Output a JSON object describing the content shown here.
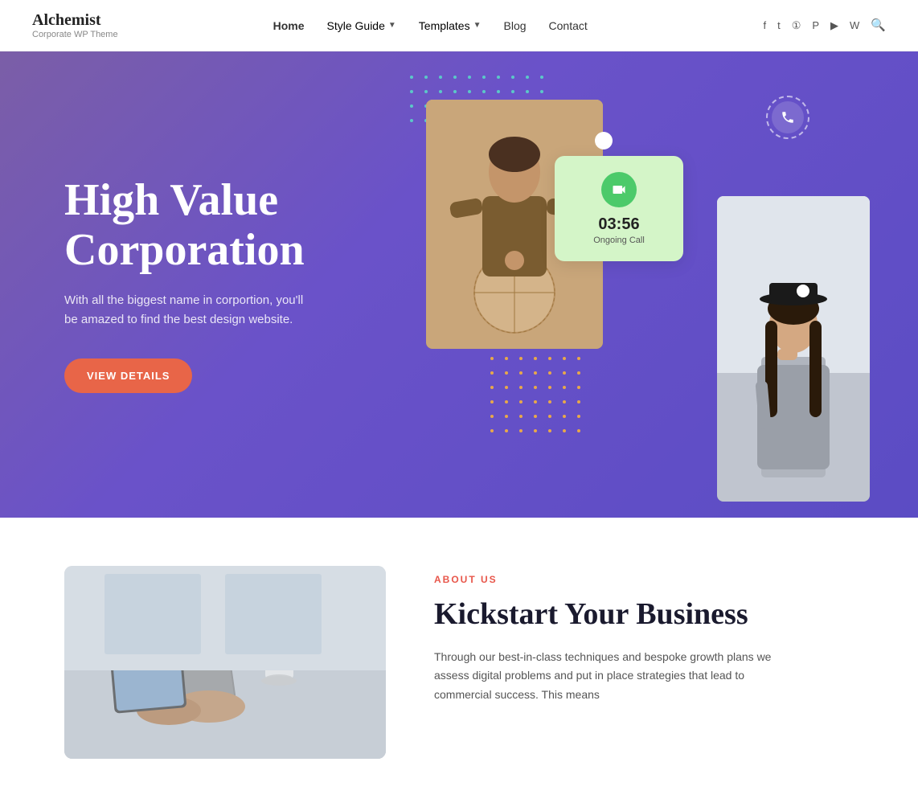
{
  "logo": {
    "name": "Alchemist",
    "tagline": "Corporate WP Theme"
  },
  "nav": {
    "links": [
      {
        "label": "Home",
        "active": true,
        "has_arrow": false
      },
      {
        "label": "Style Guide",
        "active": false,
        "has_arrow": true
      },
      {
        "label": "Templates",
        "active": false,
        "has_arrow": true
      },
      {
        "label": "Blog",
        "active": false,
        "has_arrow": false
      },
      {
        "label": "Contact",
        "active": false,
        "has_arrow": false
      }
    ],
    "icons": [
      "facebook",
      "twitter",
      "instagram",
      "pinterest",
      "youtube",
      "wordpress",
      "search"
    ]
  },
  "hero": {
    "title": "High Value Corporation",
    "subtitle": "With all the biggest name in corportion, you'll be amazed to find the best design website.",
    "cta_label": "VIEW DETAILS",
    "call_card": {
      "time": "03:56",
      "label": "Ongoing Call"
    }
  },
  "about": {
    "label": "ABOUT US",
    "title": "Kickstart Your Business",
    "text": "Through our best-in-class techniques and bespoke growth plans we assess digital problems and put in place strategies that lead to commercial success. This means"
  }
}
